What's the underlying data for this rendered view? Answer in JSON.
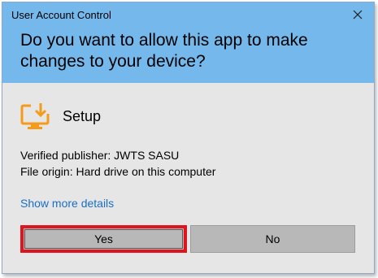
{
  "window": {
    "title": "User Account Control",
    "question": "Do you want to allow this app to make changes to your device?"
  },
  "app": {
    "name": "Setup",
    "icon": "setup-download-monitor-icon"
  },
  "details": {
    "publisher": "Verified publisher: JWTS SASU",
    "origin": "File origin: Hard drive on this computer",
    "show_more": "Show more details"
  },
  "buttons": {
    "yes": "Yes",
    "no": "No"
  },
  "colors": {
    "header": "#74b8ec",
    "body": "#e6e6e6",
    "link": "#1a6fc4",
    "highlight": "#e0141e",
    "icon": "#f59b1c"
  }
}
